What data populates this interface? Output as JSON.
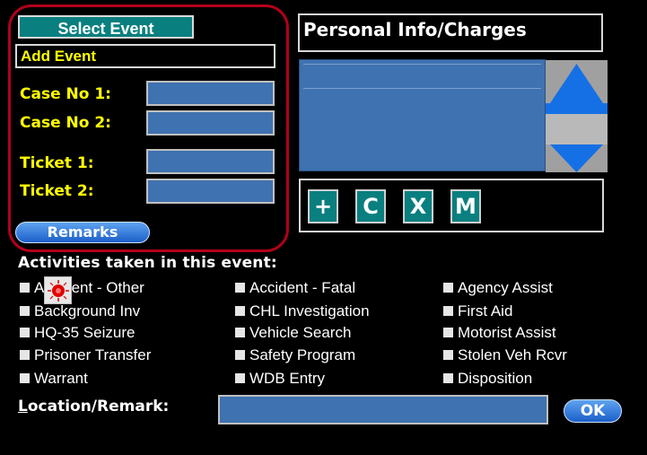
{
  "left": {
    "select_event_label": "Select Event",
    "add_event_value": "Add Event",
    "fields": [
      {
        "label": "Case No 1:"
      },
      {
        "label": "Case No 2:"
      },
      {
        "label": "Ticket 1:"
      },
      {
        "label": "Ticket 2:"
      }
    ],
    "remarks_label": "Remarks"
  },
  "right": {
    "header": "Personal Info/Charges",
    "buttons": [
      {
        "label": "+"
      },
      {
        "label": "C"
      },
      {
        "label": "X"
      },
      {
        "label": "M"
      }
    ]
  },
  "activities": {
    "title": "Activities taken in this event:",
    "columns": [
      [
        "Accident - Other",
        "Background Inv",
        "HQ-35 Seizure",
        "Prisoner Transfer",
        "Warrant"
      ],
      [
        "Accident - Fatal",
        "CHL Investigation",
        "Vehicle Search",
        "Safety Program",
        "WDB Entry"
      ],
      [
        "Agency Assist",
        "First Aid",
        "Motorist Assist",
        "Stolen Veh Rcvr",
        "Disposition"
      ]
    ]
  },
  "location": {
    "label_first": "L",
    "label_rest": "ocation/Remark:",
    "ok_label": "OK"
  },
  "colors": {
    "field_blue": "#3f72b0",
    "teal": "#0a7f7f",
    "label_yellow": "#ffff00",
    "scroll_blue": "#1570e5",
    "highlight_red": "#b3001b"
  },
  "icons": {
    "scroll_up": "triangle-up-icon",
    "scroll_down": "triangle-down-icon",
    "cursor": "target-cursor-icon"
  }
}
